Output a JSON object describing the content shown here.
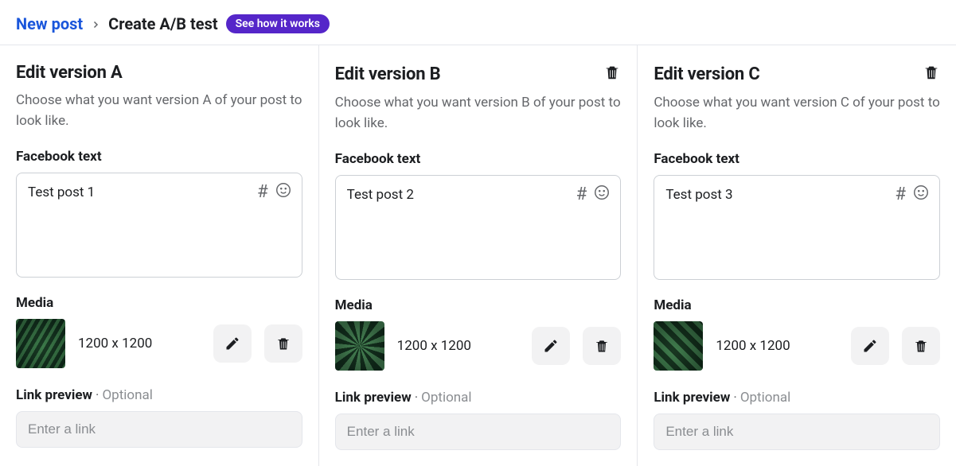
{
  "breadcrumb": {
    "root": "New post",
    "current": "Create A/B test",
    "cta": "See how it works"
  },
  "labels": {
    "fb_text": "Facebook text",
    "media": "Media",
    "link_preview": "Link preview",
    "optional": "Optional",
    "link_placeholder": "Enter a link"
  },
  "versions": [
    {
      "key": "A",
      "title": "Edit version A",
      "desc": "Choose what you want version A of your post to look like.",
      "text": "Test post 1",
      "dims": "1200 x 1200",
      "deletable": false
    },
    {
      "key": "B",
      "title": "Edit version B",
      "desc": "Choose what you want version B of your post to look like.",
      "text": "Test post 2",
      "dims": "1200 x 1200",
      "deletable": true
    },
    {
      "key": "C",
      "title": "Edit version C",
      "desc": "Choose what you want version C of your post to look like.",
      "text": "Test post 3",
      "dims": "1200 x 1200",
      "deletable": true
    }
  ]
}
